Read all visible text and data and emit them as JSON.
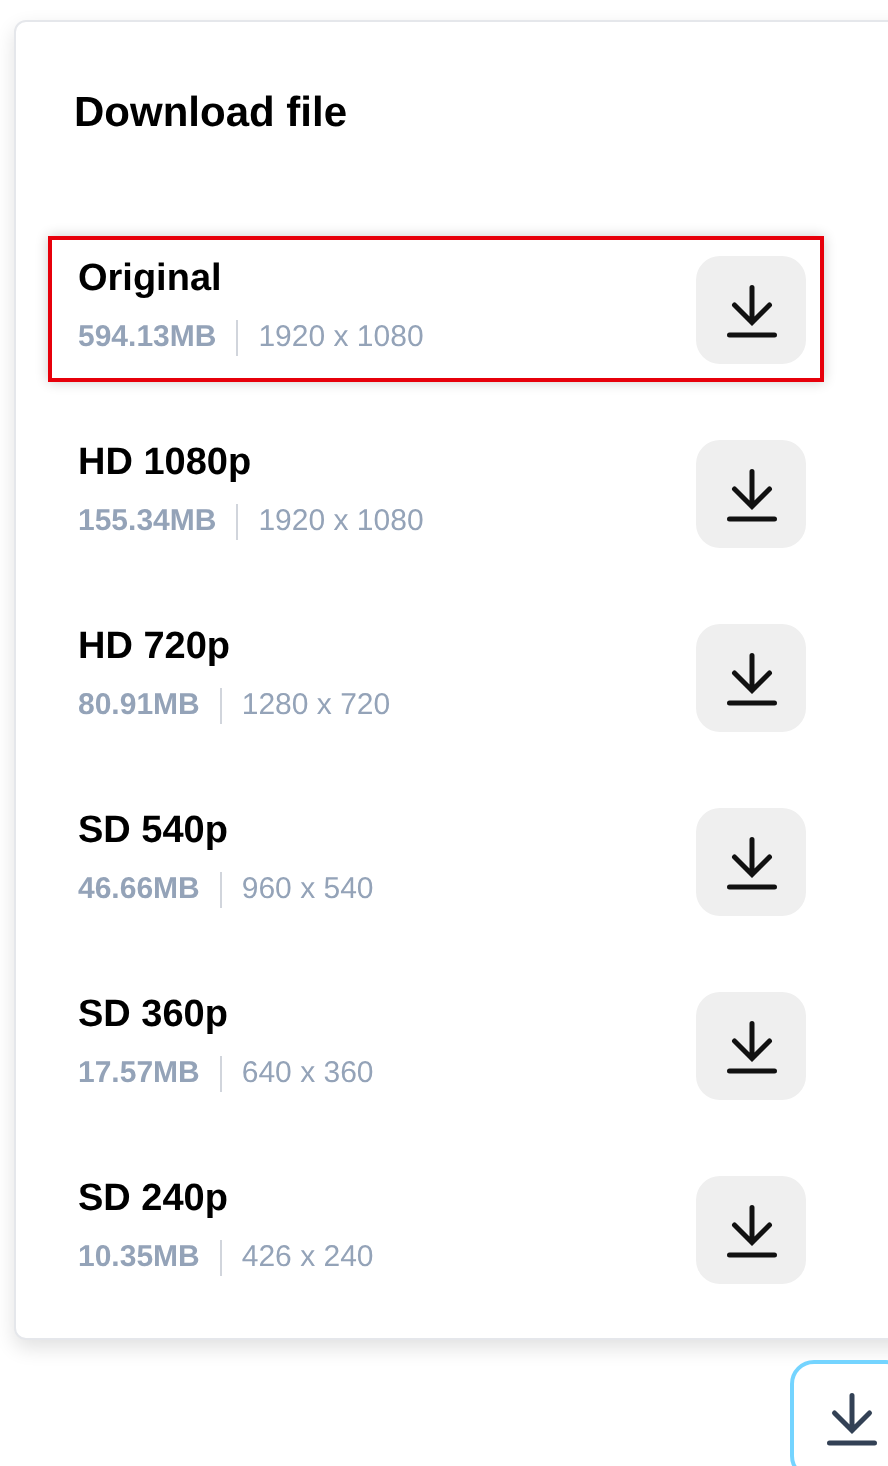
{
  "dialog": {
    "title": "Download file",
    "options": [
      {
        "label": "Original",
        "size": "594.13MB",
        "resolution": "1920 x 1080",
        "selected": true
      },
      {
        "label": "HD 1080p",
        "size": "155.34MB",
        "resolution": "1920 x 1080",
        "selected": false
      },
      {
        "label": "HD 720p",
        "size": "80.91MB",
        "resolution": "1280 x 720",
        "selected": false
      },
      {
        "label": "SD 540p",
        "size": "46.66MB",
        "resolution": "960 x 540",
        "selected": false
      },
      {
        "label": "SD 360p",
        "size": "17.57MB",
        "resolution": "640 x 360",
        "selected": false
      },
      {
        "label": "SD 240p",
        "size": "10.35MB",
        "resolution": "426 x 240",
        "selected": false
      }
    ]
  }
}
